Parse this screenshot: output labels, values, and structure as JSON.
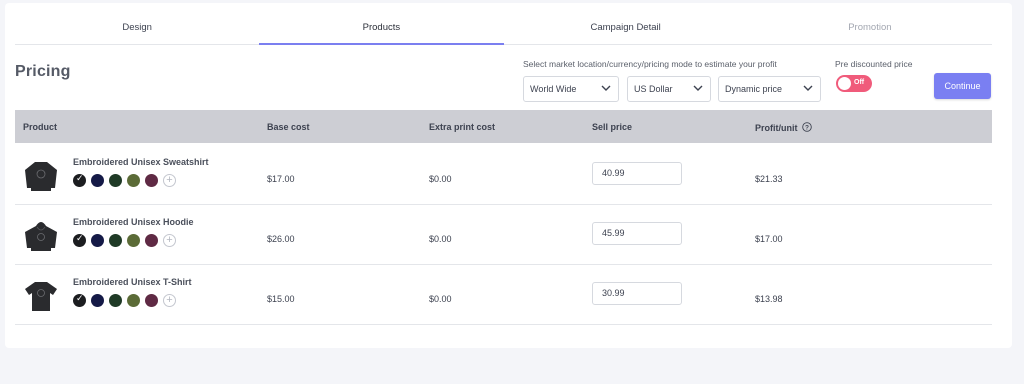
{
  "tabs": [
    "Design",
    "Products",
    "Campaign Detail",
    "Promotion"
  ],
  "page_title": "Pricing",
  "market_hint": "Select market location/currency/pricing mode to estimate your profit",
  "selects": {
    "location": "World Wide",
    "currency": "US Dollar",
    "mode": "Dynamic price"
  },
  "pre_discount": {
    "label": "Pre discounted price",
    "state": "Off"
  },
  "continue_label": "Continue",
  "columns": {
    "product": "Product",
    "base": "Base cost",
    "extra": "Extra print cost",
    "sell": "Sell price",
    "profit": "Profit/unit"
  },
  "colors": {
    "accent": "#7a7ff2",
    "toggle_off": "#f05b7b",
    "swatches": [
      "#1c1d20",
      "#151a47",
      "#1f3a26",
      "#5b6b37",
      "#5f2a44"
    ]
  },
  "rows": [
    {
      "name": "Embroidered Unisex Sweatshirt",
      "base": "$17.00",
      "extra": "$0.00",
      "sell": "40.99",
      "profit": "$21.33"
    },
    {
      "name": "Embroidered Unisex Hoodie",
      "base": "$26.00",
      "extra": "$0.00",
      "sell": "45.99",
      "profit": "$17.00"
    },
    {
      "name": "Embroidered Unisex T-Shirt",
      "base": "$15.00",
      "extra": "$0.00",
      "sell": "30.99",
      "profit": "$13.98"
    }
  ]
}
